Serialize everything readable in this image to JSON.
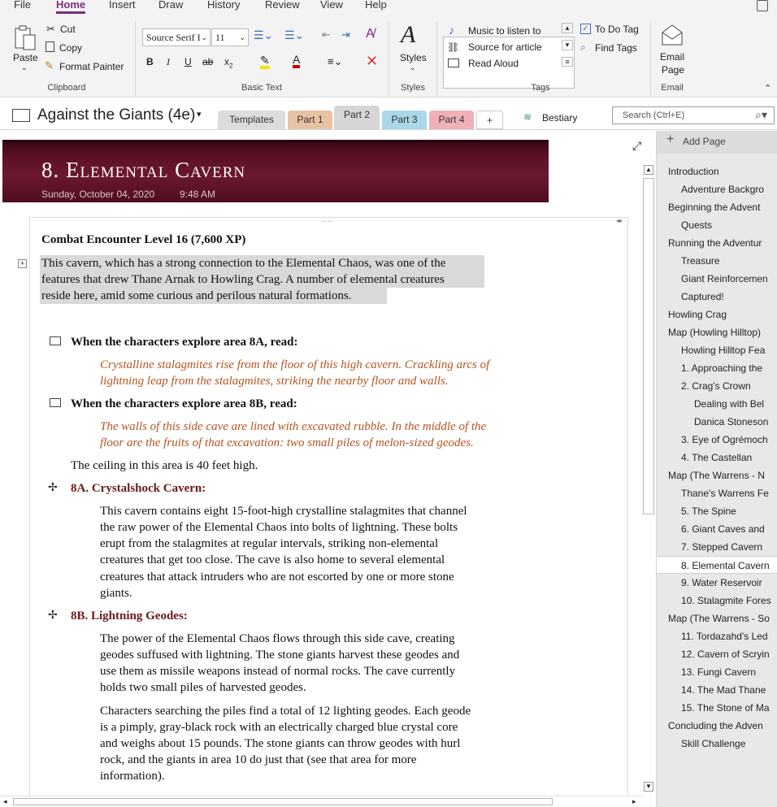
{
  "ribbon": {
    "tabs": [
      "File",
      "Home",
      "Insert",
      "Draw",
      "History",
      "Review",
      "View",
      "Help"
    ],
    "clipboard": {
      "paste": "Paste",
      "cut": "Cut",
      "copy": "Copy",
      "format_painter": "Format Painter",
      "label": "Clipboard"
    },
    "basic_text": {
      "font": "Source Serif I",
      "size": "11",
      "bold": "B",
      "italic": "I",
      "underline": "U",
      "strike": "ab",
      "sub": "x",
      "sub_suffix": "2",
      "label": "Basic Text"
    },
    "styles": {
      "button": "Styles",
      "label": "Styles"
    },
    "tags": {
      "items": [
        "Music to listen to",
        "Source for article",
        "Read Aloud"
      ],
      "todo": "To Do Tag",
      "find": "Find Tags",
      "label": "Tags"
    },
    "email": {
      "button_line1": "Email",
      "button_line2": "Page",
      "label": "Email"
    }
  },
  "notebook": {
    "title": "Against the Giants (4e)",
    "sections": [
      {
        "label": "Templates",
        "color": "#dcdcdc"
      },
      {
        "label": "Part 1",
        "color": "#e8c2a4"
      },
      {
        "label": "Part 2",
        "color": "#d6d6d6"
      },
      {
        "label": "Part 3",
        "color": "#a9d8e6"
      },
      {
        "label": "Part 4",
        "color": "#f0b0b8"
      }
    ],
    "add": "+",
    "bestiary": "Bestiary",
    "search_placeholder": "Search (Ctrl+E)"
  },
  "page": {
    "title": "8. Elemental Cavern",
    "date": "Sunday, October 04, 2020",
    "time": "9:48 AM",
    "heading": "Combat Encounter Level 16 (7,600 XP)",
    "intro": [
      "This cavern, which has a strong connection to the Elemental Chaos, was one of the",
      "features that drew Thane Arnak to Howling Crag. A number of elemental creatures",
      "reside here, amid some curious and perilous natural formations."
    ],
    "read_8a": "When the characters explore area 8A, read:",
    "read_8a_text": [
      "Crystalline stalagmites rise from the floor of this high cavern. Crackling arcs of",
      "lightning leap from the stalagmites, striking the nearby floor and walls."
    ],
    "read_8b": "When the characters explore area 8B, read:",
    "read_8b_text": [
      "The walls of this side cave are lined with excavated rubble. In the middle of the",
      "floor are the fruits of that excavation: two small piles of melon-sized geodes."
    ],
    "ceiling": "The ceiling in this area is 40 feet high.",
    "sec_8a": "8A. Crystalshock Cavern:",
    "sec_8a_text": [
      "This cavern contains eight 15-foot-high crystalline stalagmites that channel",
      "the raw power of the Elemental Chaos into bolts of lightning. These bolts",
      "erupt from the stalagmites at regular intervals, striking non-elemental",
      "creatures that get too close. The cave is also home to several elemental",
      "creatures that attack intruders who are not escorted by one or more stone",
      "giants."
    ],
    "sec_8b": "8B. Lightning Geodes:",
    "sec_8b_text1": [
      "The power of the Elemental Chaos flows through this side cave, creating",
      "geodes suffused with lightning. The stone giants harvest these geodes and",
      "use them as missile weapons instead of normal rocks. The cave currently",
      "holds two small piles of harvested geodes."
    ],
    "sec_8b_text2": [
      "Characters searching the piles find a total of 12 lighting geodes. Each geode",
      "is a pimply, gray-black rock with an electrically charged blue crystal core",
      "and weighs about 15 pounds. The stone giants can throw geodes with hurl",
      "rock, and the giants in area 10 do just that (see that area for more",
      "information)."
    ]
  },
  "pages_panel": {
    "add_page": "Add Page",
    "items": [
      {
        "label": "Introduction",
        "level": 0
      },
      {
        "label": "Adventure Backgro",
        "level": 1
      },
      {
        "label": "Beginning the Advent",
        "level": 0
      },
      {
        "label": "Quests",
        "level": 1
      },
      {
        "label": "Running the Adventur",
        "level": 0
      },
      {
        "label": "Treasure",
        "level": 1
      },
      {
        "label": "Giant Reinforcemen",
        "level": 1
      },
      {
        "label": "Captured!",
        "level": 1
      },
      {
        "label": "Howling Crag",
        "level": 0
      },
      {
        "label": "Map (Howling Hilltop)",
        "level": 0
      },
      {
        "label": "Howling Hilltop Fea",
        "level": 1
      },
      {
        "label": "1. Approaching the",
        "level": 1
      },
      {
        "label": "2. Crag's Crown",
        "level": 1
      },
      {
        "label": "Dealing with Bel",
        "level": 2
      },
      {
        "label": "Danica Stoneson",
        "level": 2
      },
      {
        "label": "3. Eye of Ogrémoch",
        "level": 1
      },
      {
        "label": "4. The Castellan",
        "level": 1
      },
      {
        "label": "Map (The Warrens - N",
        "level": 0
      },
      {
        "label": "Thane's Warrens Fe",
        "level": 1
      },
      {
        "label": "5. The Spine",
        "level": 1
      },
      {
        "label": "6. Giant Caves and",
        "level": 1
      },
      {
        "label": "7. Stepped Cavern",
        "level": 1
      },
      {
        "label": "8. Elemental Cavern",
        "level": 1,
        "selected": true
      },
      {
        "label": "9. Water Reservoir",
        "level": 1
      },
      {
        "label": "10. Stalagmite Fores",
        "level": 1
      },
      {
        "label": "Map (The Warrens - So",
        "level": 0
      },
      {
        "label": "11. Tordazahd's Led",
        "level": 1
      },
      {
        "label": "12. Cavern of Scryin",
        "level": 1
      },
      {
        "label": "13. Fungi Cavern",
        "level": 1
      },
      {
        "label": "14. The Mad Thane",
        "level": 1
      },
      {
        "label": "15. The Stone of Ma",
        "level": 1
      },
      {
        "label": "Concluding the Adven",
        "level": 0
      },
      {
        "label": "Skill Challenge",
        "level": 1
      }
    ]
  },
  "colors": {
    "accent": "#7a2e7d",
    "banner": "#5a1024",
    "read_aloud_text": "#b4541f",
    "section_heading": "#6a1a1a"
  }
}
